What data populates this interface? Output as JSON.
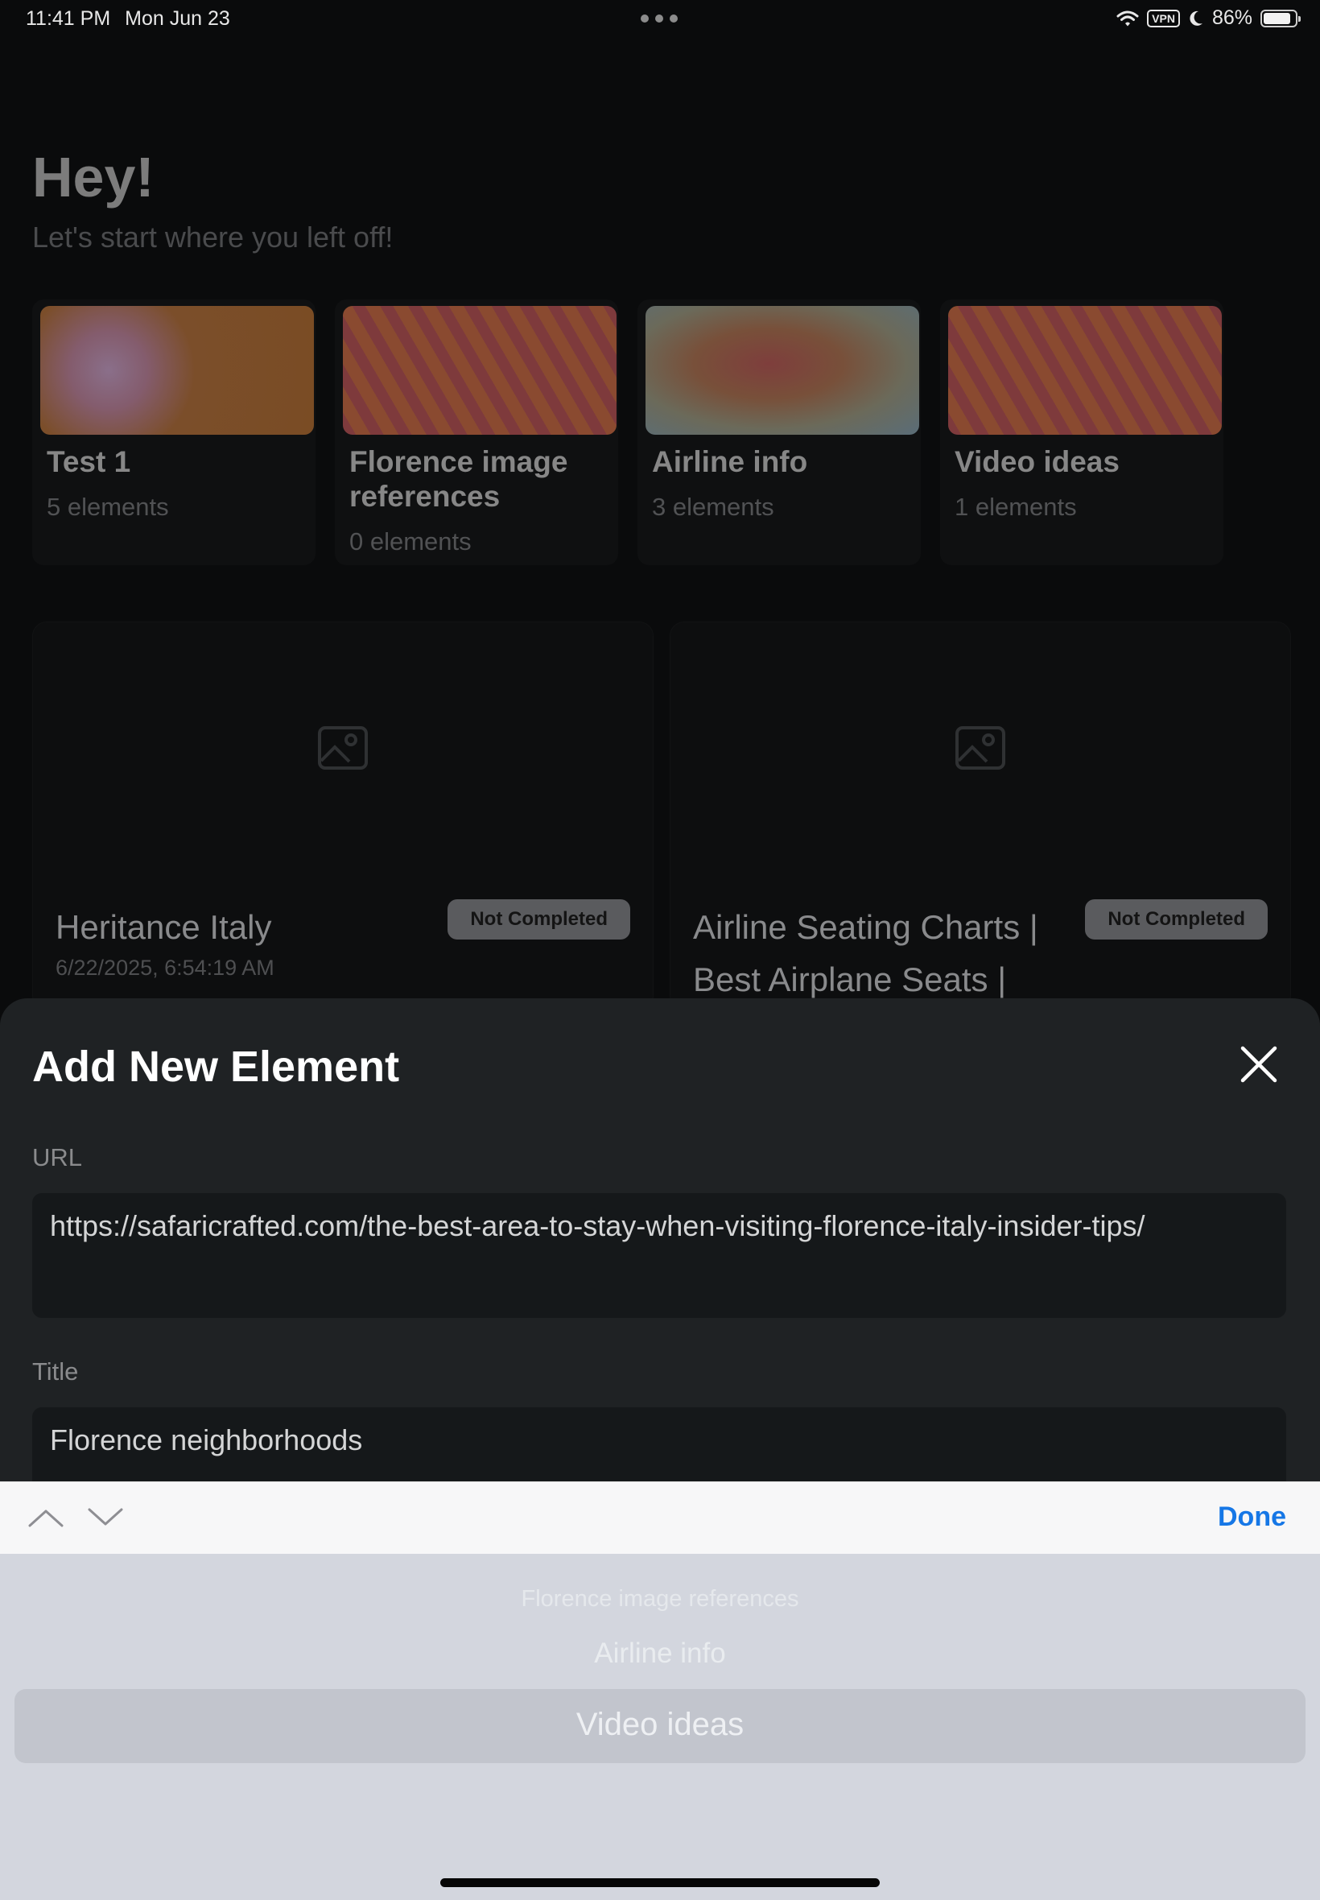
{
  "status_bar": {
    "time": "11:41 PM",
    "date": "Mon Jun 23",
    "vpn": "VPN",
    "battery": "86%",
    "battery_level": 0.86
  },
  "home": {
    "greeting": "Hey!",
    "subtitle": "Let's start where you left off!",
    "collections": [
      {
        "name": "Test 1",
        "count": "5 elements"
      },
      {
        "name": "Florence image references",
        "count": "0 elements"
      },
      {
        "name": "Airline info",
        "count": "3 elements"
      },
      {
        "name": "Video ideas",
        "count": "1 elements"
      }
    ],
    "tasks": [
      {
        "title": "Heritance Italy",
        "date": "6/22/2025, 6:54:19 AM",
        "status": "Not Completed"
      },
      {
        "title": "Airline Seating Charts | Best Airplane Seats |",
        "status": "Not Completed"
      }
    ]
  },
  "sheet": {
    "title": "Add New Element",
    "url_label": "URL",
    "url_value": "https://safaricrafted.com/the-best-area-to-stay-when-visiting-florence-italy-insider-tips/",
    "title_label": "Title",
    "title_value": "Florence neighborhoods"
  },
  "keyboard_toolbar": {
    "done_label": "Done"
  },
  "picker": {
    "options": [
      "Florence image references",
      "Airline info",
      "Video ideas"
    ],
    "selected": "Video ideas"
  },
  "colors": {
    "accent": "#1677e6",
    "sheet_bg": "#1f2224",
    "picker_bg": "#d3d6de"
  }
}
